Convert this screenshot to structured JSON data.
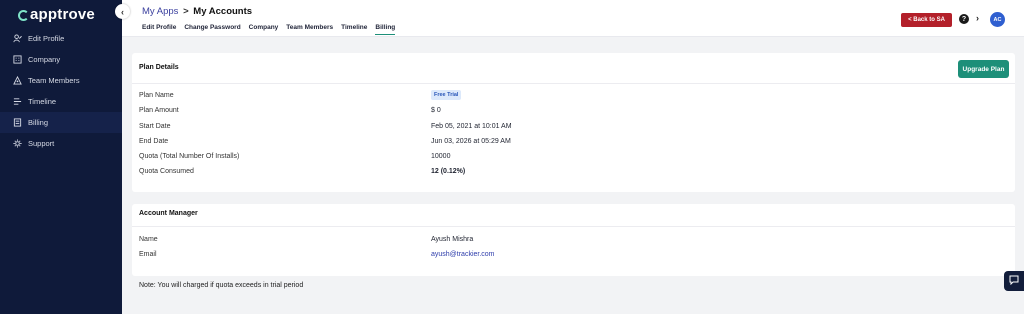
{
  "brand": {
    "name": "apptrove"
  },
  "sidebar": {
    "items": [
      {
        "label": "Edit Profile",
        "icon": "user-edit-icon",
        "active": false
      },
      {
        "label": "Company",
        "icon": "building-icon",
        "active": false
      },
      {
        "label": "Team Members",
        "icon": "team-icon",
        "active": false
      },
      {
        "label": "Timeline",
        "icon": "timeline-icon",
        "active": false
      },
      {
        "label": "Billing",
        "icon": "billing-icon",
        "active": true
      },
      {
        "label": "Support",
        "icon": "support-icon",
        "active": false
      }
    ]
  },
  "header": {
    "breadcrumb": {
      "parent": "My Apps",
      "separator": ">",
      "current": "My Accounts"
    },
    "tabs": [
      {
        "label": "Edit Profile",
        "active": false
      },
      {
        "label": "Change Password",
        "active": false
      },
      {
        "label": "Company",
        "active": false
      },
      {
        "label": "Team Members",
        "active": false
      },
      {
        "label": "Timeline",
        "active": false
      },
      {
        "label": "Billing",
        "active": true
      }
    ],
    "back_button": "< Back to SA",
    "help_glyph": "?",
    "chevron_glyph": "›",
    "avatar_initials": "AC"
  },
  "plan": {
    "title": "Plan Details",
    "upgrade_button": "Upgrade Plan",
    "rows": [
      {
        "label": "Plan Name",
        "value": "Free Trial"
      },
      {
        "label": "Plan Amount",
        "value": "$ 0"
      },
      {
        "label": "Start Date",
        "value": "Feb 05, 2021 at 10:01 AM"
      },
      {
        "label": "End Date",
        "value": "Jun 03, 2026 at 05:29 AM"
      },
      {
        "label": "Quota (Total Number Of Installs)",
        "value": "10000"
      },
      {
        "label": "Quota Consumed",
        "value": "12 (0.12%)"
      }
    ]
  },
  "account_manager": {
    "title": "Account Manager",
    "rows": [
      {
        "label": "Name",
        "value": "Ayush Mishra"
      },
      {
        "label": "Email",
        "value": "ayush@trackier.com"
      }
    ]
  },
  "note": "Note: You will charged if quota exceeds in trial period",
  "colors": {
    "sidebar_bg": "#0f1a3a",
    "accent_green": "#1d8f79",
    "back_red": "#b3202a",
    "avatar_blue": "#2f5fd0",
    "badge_bg": "#dce9fb"
  }
}
